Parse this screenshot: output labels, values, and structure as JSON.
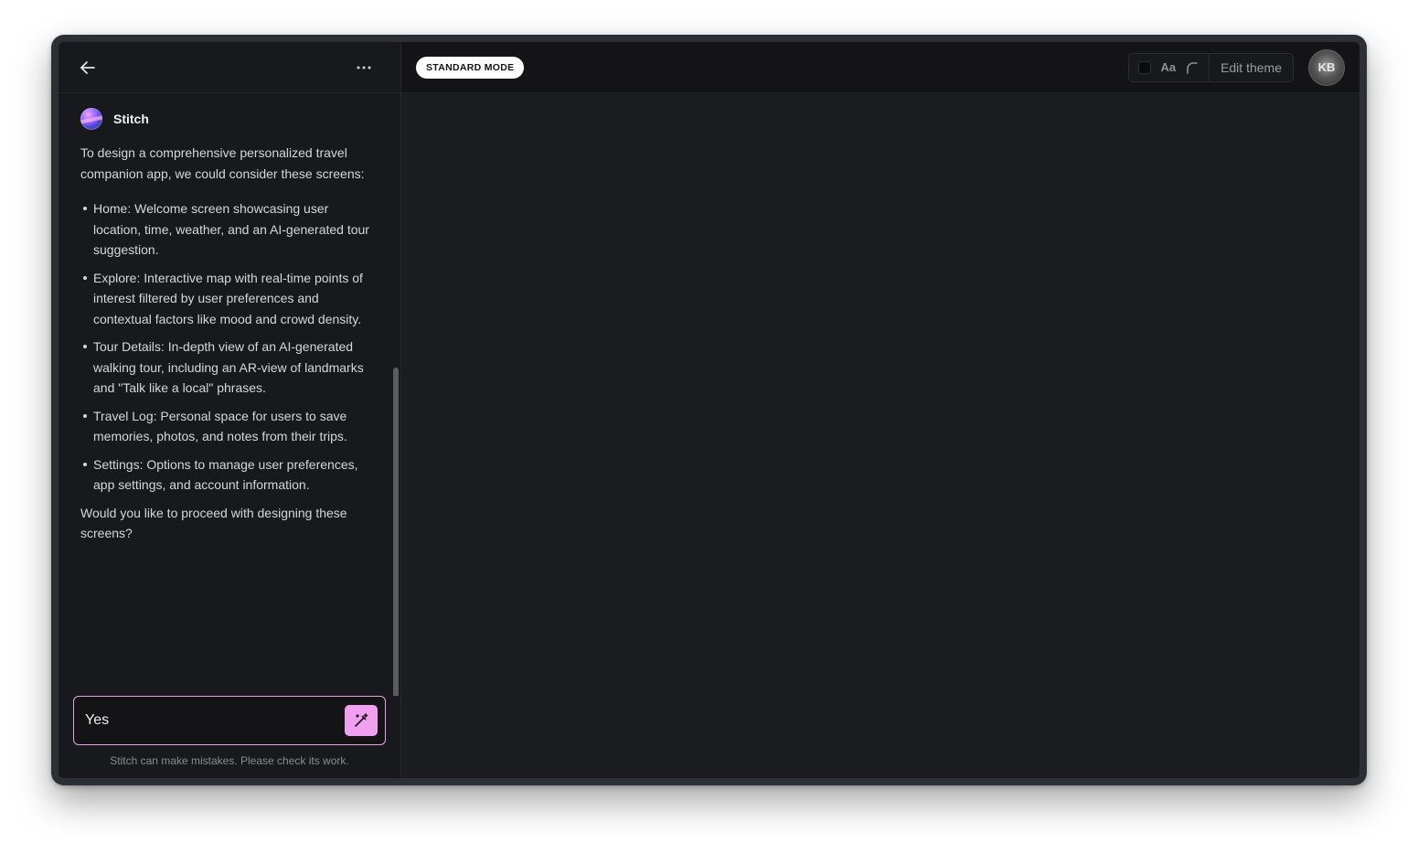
{
  "sidebar": {
    "back_icon": "arrow-left-icon",
    "more_icon": "more-horizontal-icon"
  },
  "message": {
    "sender": "Stitch",
    "intro": "To design a comprehensive personalized travel companion app, we could consider these screens:",
    "bullets": [
      "Home: Welcome screen showcasing user location, time, weather, and an AI-generated tour suggestion.",
      "Explore: Interactive map with real-time points of interest filtered by user preferences and contextual factors like mood and crowd density.",
      "Tour Details: In-depth view of an AI-generated walking tour, including an AR-view of landmarks and \"Talk like a local\" phrases.",
      "Travel Log: Personal space for users to save memories, photos, and notes from their trips.",
      "Settings: Options to manage user preferences, app settings, and account information."
    ],
    "outro": "Would you like to proceed with designing these screens?"
  },
  "composer": {
    "value": "Yes",
    "send_icon": "magic-wand-icon",
    "accent_color": "#f29ff0"
  },
  "disclaimer": "Stitch can make mistakes. Please check its work.",
  "topbar": {
    "mode_label": "STANDARD MODE",
    "font_label": "Aa",
    "edit_theme_label": "Edit theme",
    "avatar_initials": "KB"
  }
}
